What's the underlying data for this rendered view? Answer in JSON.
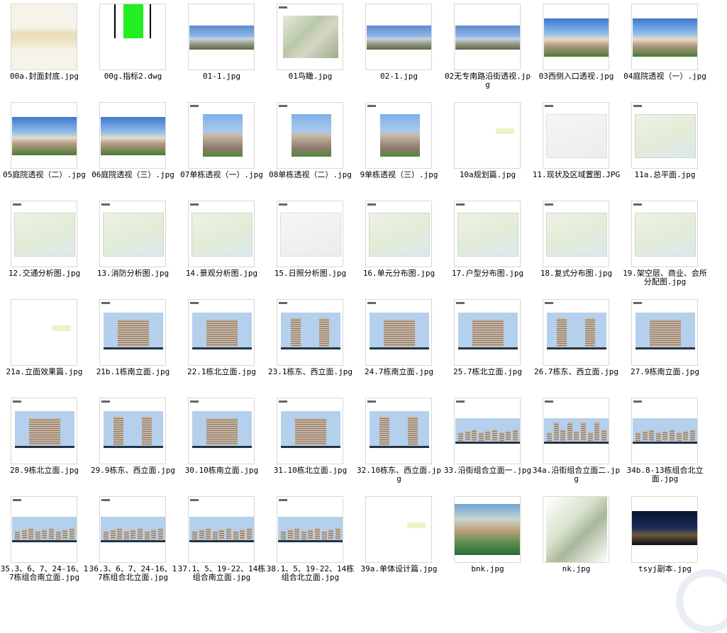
{
  "files": [
    {
      "name": "00a.封面封底.jpg",
      "kind": "cover"
    },
    {
      "name": "00g.指标2.dwg",
      "kind": "dwg"
    },
    {
      "name": "01-1.jpg",
      "kind": "pano"
    },
    {
      "name": "01鸟瞰.jpg",
      "kind": "aerial"
    },
    {
      "name": "02-1.jpg",
      "kind": "pano"
    },
    {
      "name": "02无专南路沿街透视.jpg",
      "kind": "pano"
    },
    {
      "name": "03西侧入口透视.jpg",
      "kind": "persp"
    },
    {
      "name": "04庭院透视（一）.jpg",
      "kind": "persp"
    },
    {
      "name": "05庭院透视（二）.jpg",
      "kind": "persp"
    },
    {
      "name": "06庭院透视（三）.jpg",
      "kind": "persp"
    },
    {
      "name": "07单栋透视（一）.jpg",
      "kind": "tower"
    },
    {
      "name": "08单栋透视（二）.jpg",
      "kind": "tower"
    },
    {
      "name": "9单栋透视（三）.jpg",
      "kind": "tower"
    },
    {
      "name": "10a规划篇.jpg",
      "kind": "blank"
    },
    {
      "name": "11.现状及区域置图.JPG",
      "kind": "plan-light"
    },
    {
      "name": "11a.总平面.jpg",
      "kind": "plan"
    },
    {
      "name": "12.交通分析图.jpg",
      "kind": "plan"
    },
    {
      "name": "13.消防分析图.jpg",
      "kind": "plan"
    },
    {
      "name": "14.景观分析图.jpg",
      "kind": "plan"
    },
    {
      "name": "15.日照分析图.jpg",
      "kind": "plan-light"
    },
    {
      "name": "16.单元分布图.jpg",
      "kind": "plan"
    },
    {
      "name": "17.户型分布图.jpg",
      "kind": "plan"
    },
    {
      "name": "18.复式分布图.jpg",
      "kind": "plan"
    },
    {
      "name": "19.架空层、商业、会所分配图.jpg",
      "kind": "plan"
    },
    {
      "name": "21a.立面效果篇.jpg",
      "kind": "blank"
    },
    {
      "name": "21b.1栋南立面.jpg",
      "kind": "elev-wide"
    },
    {
      "name": "22.1栋北立面.jpg",
      "kind": "elev-wide"
    },
    {
      "name": "23.1栋东、西立面.jpg",
      "kind": "elev-pair"
    },
    {
      "name": "24.7栋南立面.jpg",
      "kind": "elev-wide"
    },
    {
      "name": "25.7栋北立面.jpg",
      "kind": "elev-wide"
    },
    {
      "name": "26.7栋东、西立面.jpg",
      "kind": "elev-pair"
    },
    {
      "name": "27.9栋南立面.jpg",
      "kind": "elev-wide"
    },
    {
      "name": "28.9栋北立面.jpg",
      "kind": "elev-wide"
    },
    {
      "name": "29.9栋东、西立面.jpg",
      "kind": "elev-pair"
    },
    {
      "name": "30.10栋南立面.jpg",
      "kind": "elev-wide"
    },
    {
      "name": "31.10栋北立面.jpg",
      "kind": "elev-wide"
    },
    {
      "name": "32.10栋东、西立面.jpg",
      "kind": "elev-pair"
    },
    {
      "name": "33.沿街组合立面一.jpg",
      "kind": "strip"
    },
    {
      "name": "34a.沿街组合立面二.jpg",
      "kind": "strip-tall"
    },
    {
      "name": "34b.8-13栋组合北立面.jpg",
      "kind": "strip"
    },
    {
      "name": "35.3、6、7、24-16、17栋组合南立面.jpg",
      "kind": "strip"
    },
    {
      "name": "36.3、6、7、24-16、17栋组合北立面.jpg",
      "kind": "strip"
    },
    {
      "name": "37.1、5、19-22、14栋组合南立面.jpg",
      "kind": "strip"
    },
    {
      "name": "38.1、5、19-22、14栋组合北立面.jpg",
      "kind": "strip"
    },
    {
      "name": "39a.单体设计篇.jpg",
      "kind": "blank"
    },
    {
      "name": "bnk.jpg",
      "kind": "photo-green"
    },
    {
      "name": "nk.jpg",
      "kind": "photo-white"
    },
    {
      "name": "tsyj副本.jpg",
      "kind": "photo-night"
    }
  ]
}
